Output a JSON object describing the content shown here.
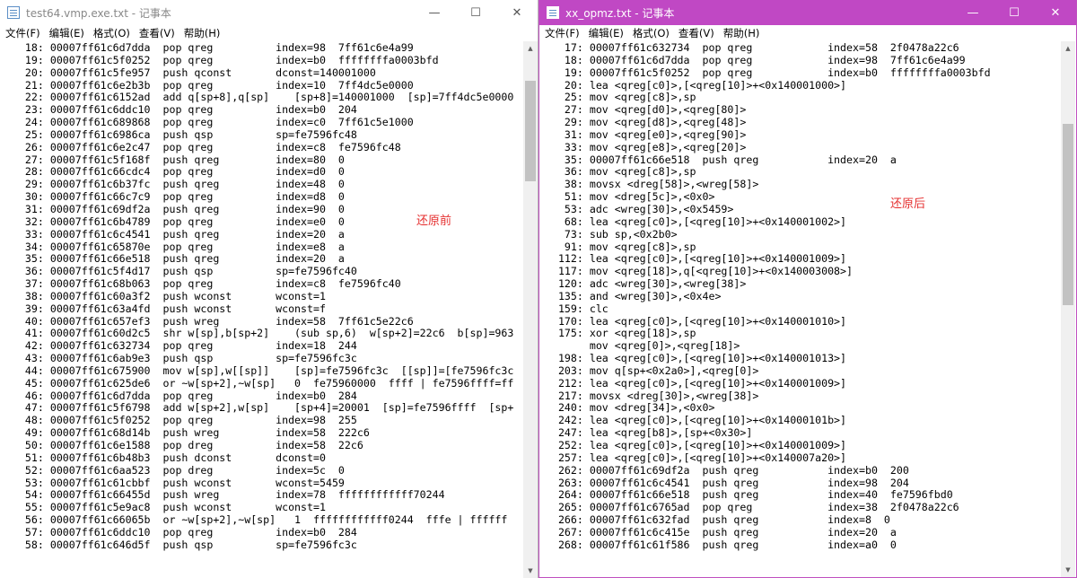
{
  "left_window": {
    "title": "test64.vmp.exe.txt - 记事本",
    "menu": [
      "文件(F)",
      "编辑(E)",
      "格式(O)",
      "查看(V)",
      "帮助(H)"
    ],
    "annotation": "还原前",
    "lines": [
      "    18: 00007ff61c6d7dda  pop qreg          index=98  7ff61c6e4a99",
      "    19: 00007ff61c5f0252  pop qreg          index=b0  ffffffffa0003bfd",
      "    20: 00007ff61c5fe957  push qconst       dconst=140001000",
      "    21: 00007ff61c6e2b3b  pop qreg          index=10  7ff4dc5e0000",
      "    22: 00007ff61c6152ad  add q[sp+8],q[sp]    [sp+8]=140001000  [sp]=7ff4dc5e0000",
      "    23: 00007ff61c6ddc10  pop qreg          index=b0  204",
      "    24: 00007ff61c689868  pop qreg          index=c0  7ff61c5e1000",
      "    25: 00007ff61c6986ca  push qsp          sp=fe7596fc48",
      "    26: 00007ff61c6e2c47  pop qreg          index=c8  fe7596fc48",
      "    27: 00007ff61c5f168f  push qreg         index=80  0",
      "    28: 00007ff61c66cdc4  pop qreg          index=d0  0",
      "    29: 00007ff61c6b37fc  push qreg         index=48  0",
      "    30: 00007ff61c66c7c9  pop qreg          index=d8  0",
      "    31: 00007ff61c69df2a  push qreg         index=90  0",
      "    32: 00007ff61c6b4789  pop qreg          index=e0  0",
      "    33: 00007ff61c6c4541  push qreg         index=20  a",
      "    34: 00007ff61c65870e  pop qreg          index=e8  a",
      "    35: 00007ff61c66e518  push qreg         index=20  a",
      "    36: 00007ff61c5f4d17  push qsp          sp=fe7596fc40",
      "    37: 00007ff61c68b063  pop qreg          index=c8  fe7596fc40",
      "    38: 00007ff61c60a3f2  push wconst       wconst=1",
      "    39: 00007ff61c63a4fd  push wconst       wconst=f",
      "    40: 00007ff61c657ef3  push wreg         index=58  7ff61c5e22c6",
      "    41: 00007ff61c60d2c5  shr w[sp],b[sp+2]    (sub sp,6)  w[sp+2]=22c6  b[sp]=963",
      "    42: 00007ff61c632734  pop qreg          index=18  244",
      "    43: 00007ff61c6ab9e3  push qsp          sp=fe7596fc3c",
      "    44: 00007ff61c675900  mov w[sp],w[[sp]]    [sp]=fe7596fc3c  [[sp]]=[fe7596fc3c",
      "    45: 00007ff61c625de6  or ~w[sp+2],~w[sp]   0  fe75960000  ffff | fe7596ffff=ff",
      "    46: 00007ff61c6d7dda  pop qreg          index=b0  284",
      "    47: 00007ff61c5f6798  add w[sp+2],w[sp]    [sp+4]=20001  [sp]=fe7596ffff  [sp+",
      "    48: 00007ff61c5f0252  pop qreg          index=98  255",
      "    49: 00007ff61c68d14b  push wreg         index=58  222c6",
      "    50: 00007ff61c6e1588  pop dreg          index=58  22c6",
      "    51: 00007ff61c6b48b3  push dconst       dconst=0",
      "    52: 00007ff61c6aa523  pop dreg          index=5c  0",
      "    53: 00007ff61c61cbbf  push wconst       wconst=5459",
      "    54: 00007ff61c66455d  push wreg         index=78  ffffffffffff70244",
      "    55: 00007ff61c5e9ac8  push wconst       wconst=1",
      "    56: 00007ff61c66065b  or ~w[sp+2],~w[sp]   1  ffffffffffff0244  fffe | ffffff",
      "    57: 00007ff61c6ddc10  pop qreg          index=b0  284",
      "    58: 00007ff61c646d5f  push qsp          sp=fe7596fc3c"
    ]
  },
  "right_window": {
    "title": "xx_opmz.txt - 记事本",
    "menu": [
      "文件(F)",
      "编辑(E)",
      "格式(O)",
      "查看(V)",
      "帮助(H)"
    ],
    "annotation": "还原后",
    "lines": [
      "    17: 00007ff61c632734  pop qreg            index=58  2f0478a22c6",
      "    18: 00007ff61c6d7dda  pop qreg            index=98  7ff61c6e4a99",
      "    19: 00007ff61c5f0252  pop qreg            index=b0  ffffffffa0003bfd",
      "    20: lea <qreg[c0]>,[<qreg[10]>+<0x140001000>]",
      "    25: mov <qreg[c8]>,sp",
      "    27: mov <qreg[d0]>,<qreg[80]>",
      "    29: mov <qreg[d8]>,<qreg[48]>",
      "    31: mov <qreg[e0]>,<qreg[90]>",
      "    33: mov <qreg[e8]>,<qreg[20]>",
      "    35: 00007ff61c66e518  push qreg           index=20  a",
      "    36: mov <qreg[c8]>,sp",
      "    38: movsx <dreg[58]>,<wreg[58]>",
      "    51: mov <dreg[5c]>,<0x0>",
      "    53: adc <wreg[30]>,<0x5459>",
      "    68: lea <qreg[c0]>,[<qreg[10]>+<0x140001002>]",
      "    73: sub sp,<0x2b0>",
      "    91: mov <qreg[c8]>,sp",
      "   112: lea <qreg[c0]>,[<qreg[10]>+<0x140001009>]",
      "   117: mov <qreg[18]>,q[<qreg[10]>+<0x140003008>]",
      "   120: adc <wreg[30]>,<wreg[38]>",
      "   135: and <wreg[30]>,<0x4e>",
      "   159: clc",
      "   170: lea <qreg[c0]>,[<qreg[10]>+<0x140001010>]",
      "   175: xor <qreg[18]>,sp",
      "        mov <qreg[0]>,<qreg[18]>",
      "   198: lea <qreg[c0]>,[<qreg[10]>+<0x140001013>]",
      "   203: mov q[sp+<0x2a0>],<qreg[0]>",
      "   212: lea <qreg[c0]>,[<qreg[10]>+<0x140001009>]",
      "   217: movsx <dreg[30]>,<wreg[38]>",
      "   240: mov <dreg[34]>,<0x0>",
      "   242: lea <qreg[c0]>,[<qreg[10]>+<0x14000101b>]",
      "   247: lea <qreg[b8]>,[sp+<0x30>]",
      "   252: lea <qreg[c0]>,[<qreg[10]>+<0x140001009>]",
      "   257: lea <qreg[c0]>,[<qreg[10]>+<0x140007a20>]",
      "   262: 00007ff61c69df2a  push qreg           index=b0  200",
      "   263: 00007ff61c6c4541  push qreg           index=98  204",
      "   264: 00007ff61c66e518  push qreg           index=40  fe7596fbd0",
      "   265: 00007ff61c6765ad  pop qreg            index=38  2f0478a22c6",
      "   266: 00007ff61c632fad  push qreg           index=8  0",
      "   267: 00007ff61c6c415e  push qreg           index=20  a",
      "   268: 00007ff61c61f586  push qreg           index=a0  0"
    ]
  }
}
